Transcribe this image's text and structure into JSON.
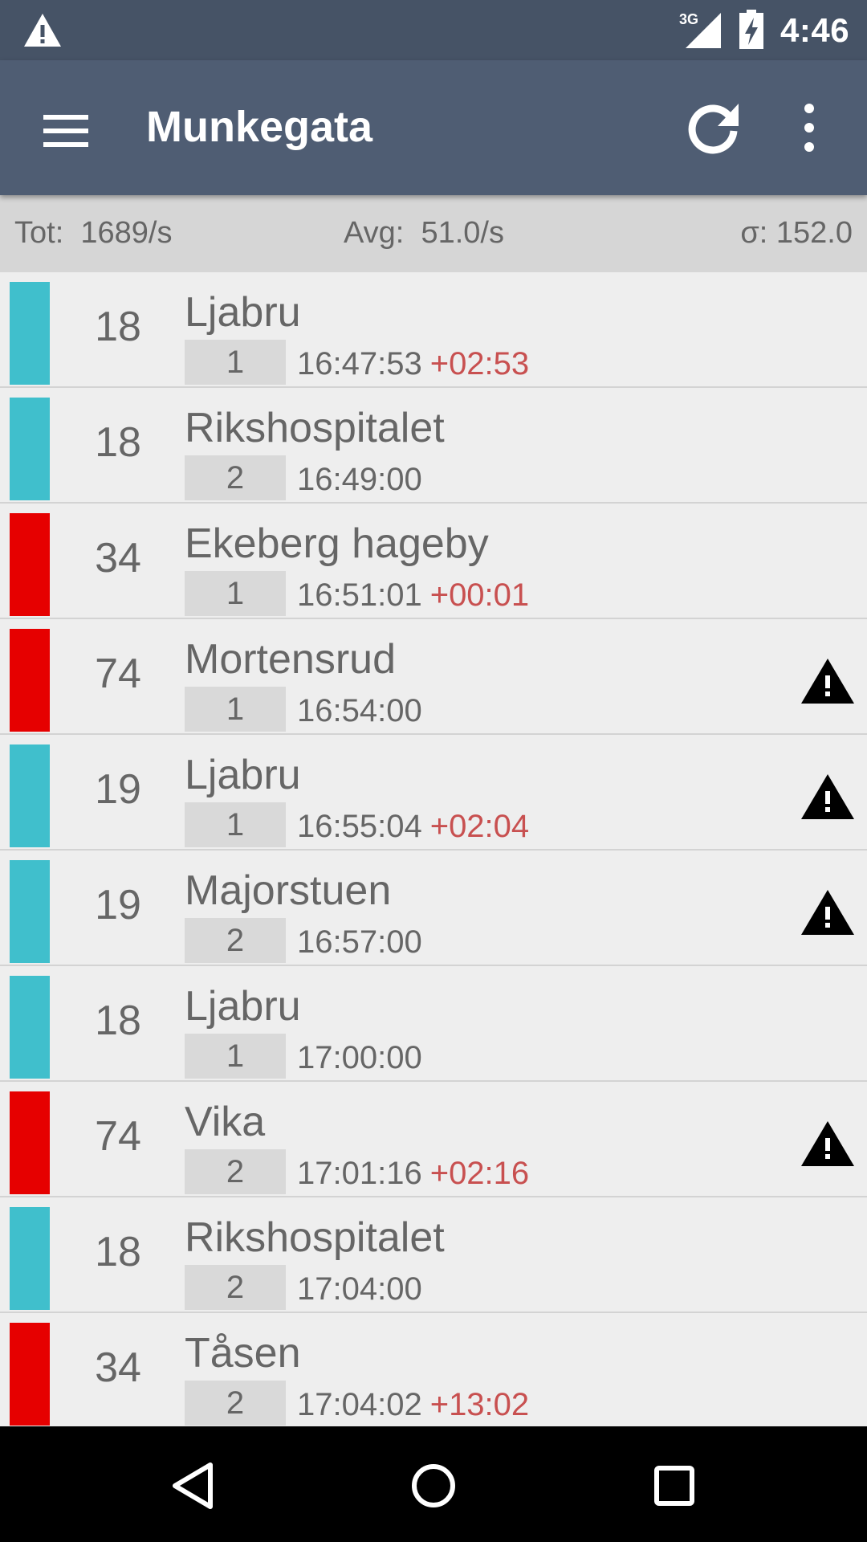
{
  "status_bar": {
    "network_label": "3G",
    "clock": "4:46",
    "icons": [
      "warning-icon",
      "signal-icon",
      "battery-charging-icon"
    ]
  },
  "app_bar": {
    "title": "Munkegata",
    "icons": [
      "menu-icon",
      "refresh-icon",
      "more-vert-icon"
    ]
  },
  "stats": {
    "tot": "Tot:  1689/s",
    "avg": "Avg:  51.0/s",
    "sigma": "σ: 152.0"
  },
  "departures": [
    {
      "line": "18",
      "destination": "Ljabru",
      "track": "1",
      "time": "16:47:53",
      "delay": "+02:53",
      "color": "#40bfcc",
      "alert": false
    },
    {
      "line": "18",
      "destination": "Rikshospitalet",
      "track": "2",
      "time": "16:49:00",
      "delay": "",
      "color": "#40bfcc",
      "alert": false
    },
    {
      "line": "34",
      "destination": "Ekeberg hageby",
      "track": "1",
      "time": "16:51:01",
      "delay": "+00:01",
      "color": "#e60000",
      "alert": false
    },
    {
      "line": "74",
      "destination": "Mortensrud",
      "track": "1",
      "time": "16:54:00",
      "delay": "",
      "color": "#e60000",
      "alert": true
    },
    {
      "line": "19",
      "destination": "Ljabru",
      "track": "1",
      "time": "16:55:04",
      "delay": "+02:04",
      "color": "#40bfcc",
      "alert": true
    },
    {
      "line": "19",
      "destination": "Majorstuen",
      "track": "2",
      "time": "16:57:00",
      "delay": "",
      "color": "#40bfcc",
      "alert": true
    },
    {
      "line": "18",
      "destination": "Ljabru",
      "track": "1",
      "time": "17:00:00",
      "delay": "",
      "color": "#40bfcc",
      "alert": false
    },
    {
      "line": "74",
      "destination": "Vika",
      "track": "2",
      "time": "17:01:16",
      "delay": "+02:16",
      "color": "#e60000",
      "alert": true
    },
    {
      "line": "18",
      "destination": "Rikshospitalet",
      "track": "2",
      "time": "17:04:00",
      "delay": "",
      "color": "#40bfcc",
      "alert": false
    },
    {
      "line": "34",
      "destination": "Tåsen",
      "track": "2",
      "time": "17:04:02",
      "delay": "+13:02",
      "color": "#e60000",
      "alert": false
    }
  ],
  "nav_bar": {
    "icons": [
      "back-icon",
      "home-icon",
      "recents-icon"
    ]
  }
}
